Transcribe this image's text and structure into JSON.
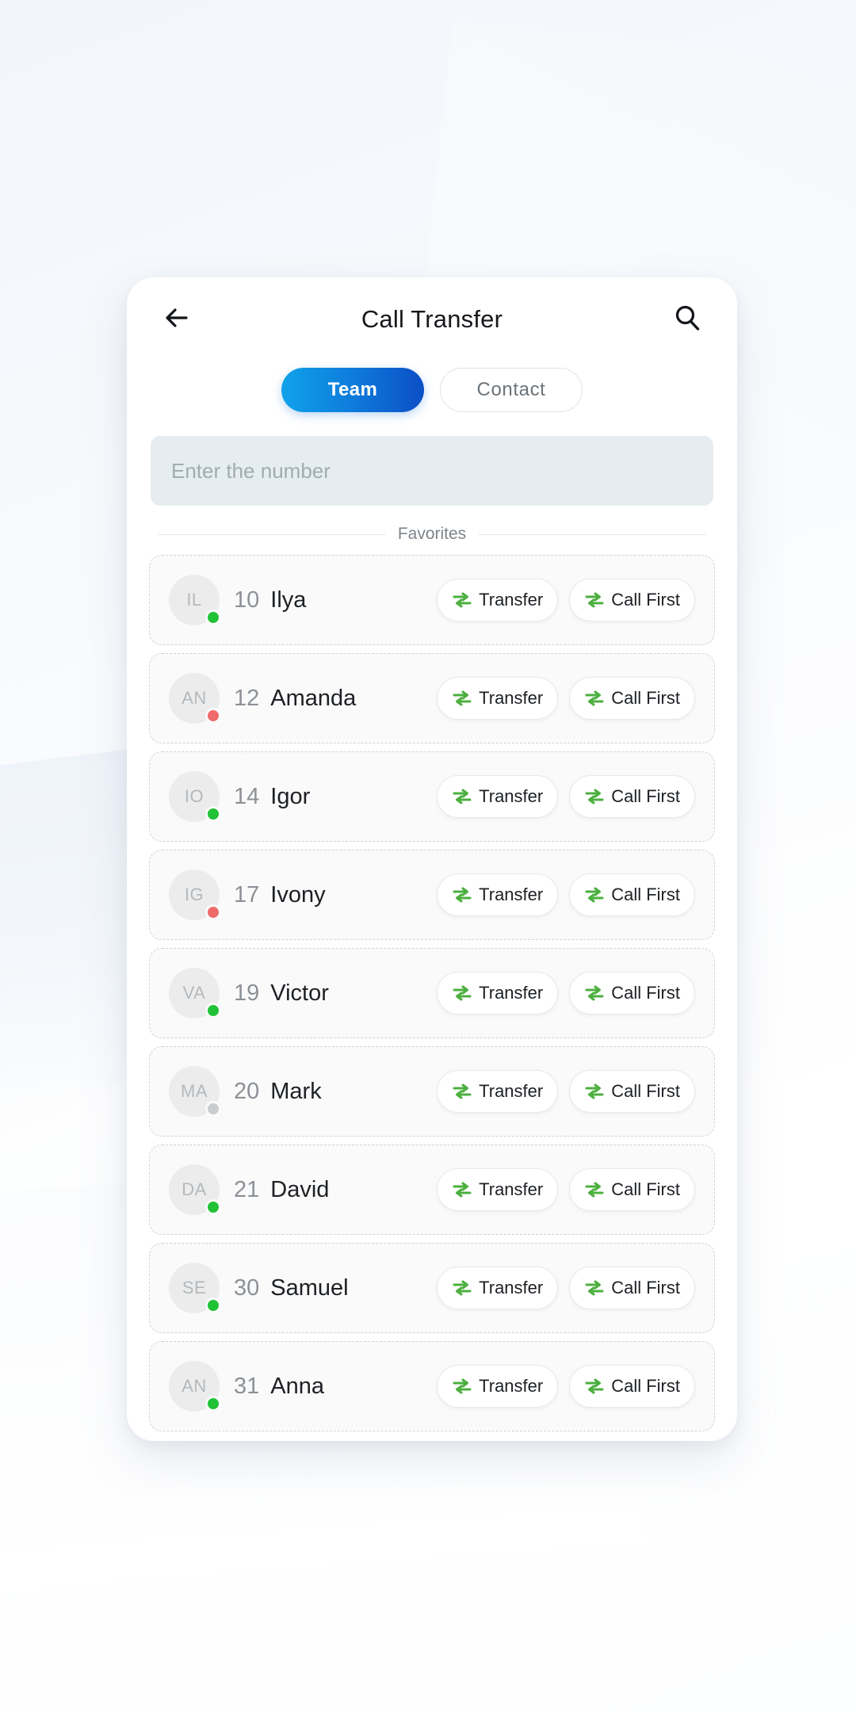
{
  "header": {
    "title": "Call Transfer",
    "back_icon": "arrow-left-icon",
    "search_icon": "search-icon"
  },
  "tabs": [
    {
      "label": "Team",
      "active": true
    },
    {
      "label": "Contact",
      "active": false
    }
  ],
  "number_input": {
    "placeholder": "Enter the number",
    "value": ""
  },
  "favorites": {
    "label": "Favorites"
  },
  "actions": {
    "transfer_label": "Transfer",
    "call_first_label": "Call First",
    "transfer_icon": "transfer-arrows-icon"
  },
  "colors": {
    "accent_start": "#0fa2ea",
    "accent_end": "#0c4fc6",
    "status_online": "#22c236",
    "status_busy": "#ef6b6b",
    "status_offline": "#c9cccf",
    "icon_green": "#4caf3f",
    "input_bg": "#e6edf0"
  },
  "contacts": [
    {
      "initials": "IL",
      "ext": "10",
      "name": "Ilya",
      "status": "online"
    },
    {
      "initials": "AN",
      "ext": "12",
      "name": "Amanda",
      "status": "busy"
    },
    {
      "initials": "IO",
      "ext": "14",
      "name": "Igor",
      "status": "online"
    },
    {
      "initials": "IG",
      "ext": "17",
      "name": "Ivony",
      "status": "busy"
    },
    {
      "initials": "VA",
      "ext": "19",
      "name": "Victor",
      "status": "online"
    },
    {
      "initials": "MA",
      "ext": "20",
      "name": "Mark",
      "status": "offline"
    },
    {
      "initials": "DA",
      "ext": "21",
      "name": "David",
      "status": "online"
    },
    {
      "initials": "SE",
      "ext": "30",
      "name": "Samuel",
      "status": "online"
    },
    {
      "initials": "AN",
      "ext": "31",
      "name": "Anna",
      "status": "online"
    }
  ]
}
